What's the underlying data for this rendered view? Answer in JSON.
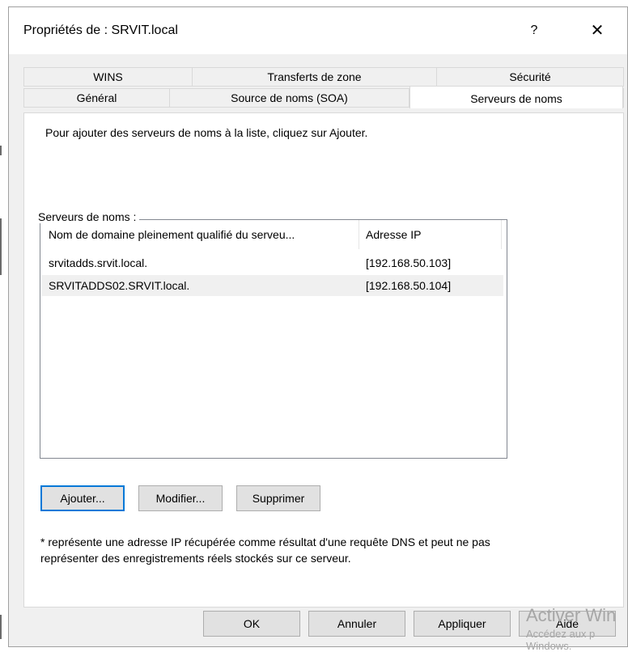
{
  "window": {
    "title": "Propriétés de : SRVIT.local",
    "help_glyph": "?",
    "close_glyph": "✕"
  },
  "tabs": {
    "row_top": [
      "WINS",
      "Transferts de zone",
      "Sécurité"
    ],
    "row_bottom": [
      "Général",
      "Source de noms (SOA)",
      "Serveurs de noms"
    ],
    "selected": "Serveurs de noms"
  },
  "panel": {
    "instruction": "Pour ajouter des serveurs de noms à la liste, cliquez sur Ajouter.",
    "list_label": "Serveurs de noms :",
    "columns": [
      "Nom de domaine pleinement qualifié du serveu...",
      "Adresse IP"
    ],
    "rows": [
      {
        "fqdn": "srvitadds.srvit.local.",
        "ip": "[192.168.50.103]"
      },
      {
        "fqdn": "SRVITADDS02.SRVIT.local.",
        "ip": "[192.168.50.104]"
      }
    ],
    "buttons": {
      "add": "Ajouter...",
      "edit": "Modifier...",
      "remove": "Supprimer"
    },
    "note_line1": "* représente une adresse IP récupérée comme résultat d'une requête DNS et peut ne pas",
    "note_line2": "représenter des enregistrements réels stockés sur ce serveur."
  },
  "footer": {
    "ok": "OK",
    "cancel": "Annuler",
    "apply": "Appliquer",
    "help": "Aide"
  },
  "watermark": {
    "line1": "Activer Win",
    "line2": "Accédez aux p",
    "line3": "Windows."
  },
  "colors": {
    "accent": "#0078d7",
    "dialog_bg": "#f0f0f0",
    "button_bg": "#e1e1e1"
  }
}
